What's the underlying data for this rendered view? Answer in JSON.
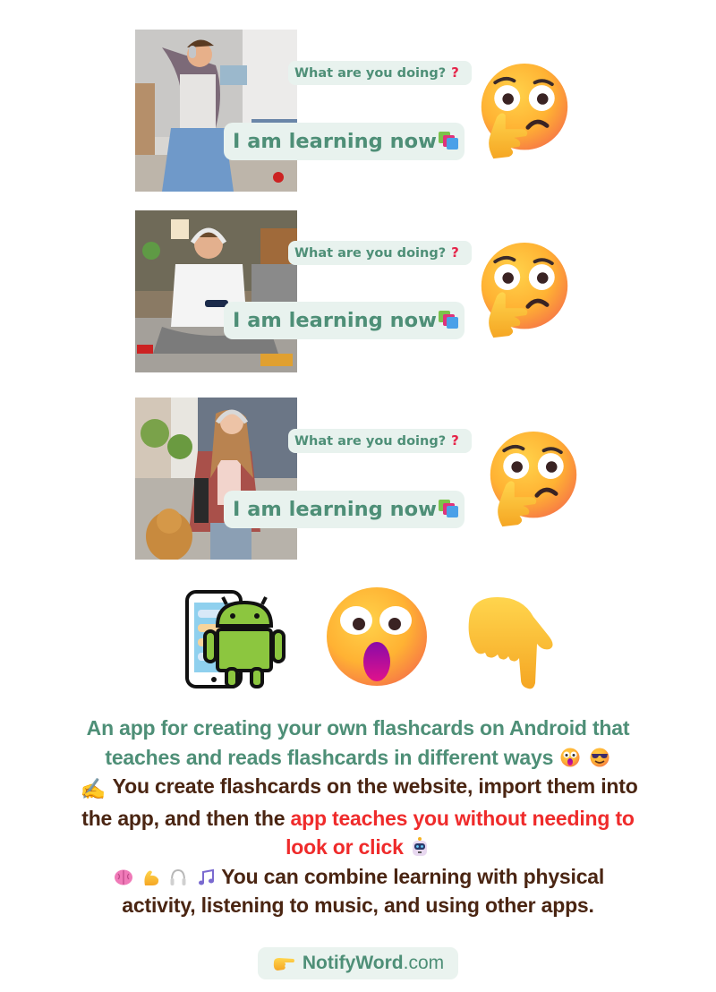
{
  "scenes": [
    {
      "photo": "young man with headphones dancing in living room",
      "question": "What are you doing?",
      "question_icon": "red-question-mark-icon",
      "answer": "I am learning now",
      "answer_icon": "books-icon",
      "reaction_icon": "thinking-face-icon"
    },
    {
      "photo": "teen with headphones playing video game on bed",
      "question": "What are you doing?",
      "question_icon": "red-question-mark-icon",
      "answer": "I am learning now",
      "answer_icon": "books-icon",
      "reaction_icon": "thinking-face-icon"
    },
    {
      "photo": "girl with headphones walking a golden retriever in the city",
      "question": "What are you doing?",
      "question_icon": "red-question-mark-icon",
      "answer": "I am learning now",
      "answer_icon": "books-icon",
      "reaction_icon": "thinking-face-icon"
    }
  ],
  "icons_row": [
    "android-phone-icon",
    "astonished-face-icon",
    "pointing-down-hand-icon"
  ],
  "description": {
    "line1": "An app for creating your own flashcards on Android that",
    "line2": "teaches and reads flashcards in different ways",
    "line2_icons": [
      "astonished-face-icon",
      "smiling-face-sunglasses-icon"
    ],
    "p2_icon": "writing-hand-icon",
    "p2_text_a": "You create flashcards on the website, import them into",
    "p2_text_b": "the app, and then the",
    "p2_highlight_a": "app teaches you without needing to",
    "p2_highlight_b": "look or click",
    "p2_end_icon": "robot-icon",
    "p3_icons": [
      "brain-icon",
      "flexed-biceps-icon",
      "headphones-icon",
      "music-notes-icon"
    ],
    "p3_text_a": "You can combine learning with physical",
    "p3_text_b": "activity, listening to music, and using other apps."
  },
  "footer": {
    "icon": "pointing-right-hand-icon",
    "site_name": "NotifyWord",
    "site_tld": ".com"
  },
  "colors": {
    "green": "#4e8f77",
    "bubble_bg": "#e8f2ee",
    "brown": "#4a2512",
    "red": "#ef2b2b",
    "question_red": "#e5254a"
  }
}
